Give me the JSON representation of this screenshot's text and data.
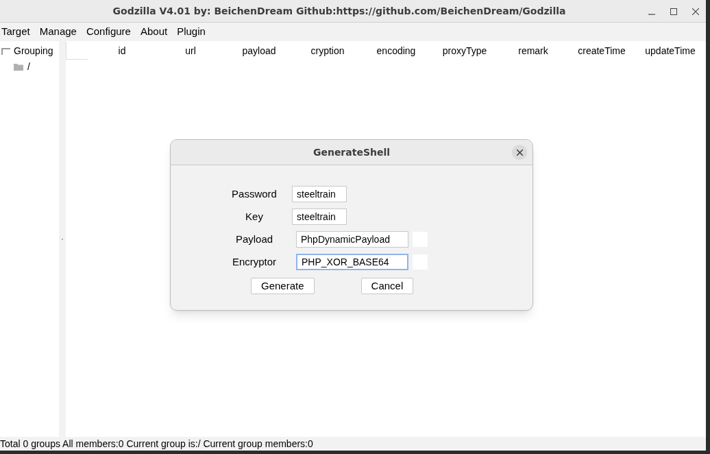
{
  "window": {
    "title": "Godzilla V4.01 by: BeichenDream Github:https://github.com/BeichenDream/Godzilla"
  },
  "menu": [
    "Target",
    "Manage",
    "Configure",
    "About",
    "Plugin"
  ],
  "tree": {
    "label": "Grouping",
    "children": [
      {
        "label": "/"
      }
    ]
  },
  "table": {
    "columns": [
      "id",
      "url",
      "payload",
      "cryption",
      "encoding",
      "proxyType",
      "remark",
      "createTime",
      "updateTime"
    ]
  },
  "dialog": {
    "title": "GenerateShell",
    "fields": [
      {
        "kind": "text",
        "label": "Password",
        "value": "steeltrain",
        "focused": false
      },
      {
        "kind": "text",
        "label": "Key",
        "value": "steeltrain",
        "focused": false
      },
      {
        "kind": "select",
        "label": "Payload",
        "value": "PhpDynamicPayload",
        "focused": false
      },
      {
        "kind": "select",
        "label": "Encryptor",
        "value": "PHP_XOR_BASE64",
        "focused": true
      }
    ],
    "buttons": [
      "Generate",
      "Cancel"
    ]
  },
  "status_bar": "Total 0 groups All members:0 Current group is:/ Current group members:0"
}
